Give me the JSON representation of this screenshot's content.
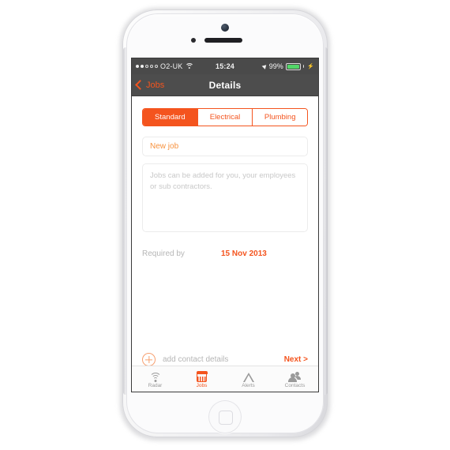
{
  "device": {
    "name": "white-iphone-5",
    "camera_icon": "camera-icon",
    "speaker_icon": "speaker-grille-icon",
    "home_button_icon": "home-button-icon"
  },
  "status_bar": {
    "signal_icon": "signal-dots-icon",
    "signal_bars_filled": 2,
    "signal_bars_total": 5,
    "carrier": "O2-UK",
    "wifi_icon": "wifi-icon",
    "time": "15:24",
    "location_icon": "location-arrow-icon",
    "battery_percent": "99%",
    "battery_level": 99,
    "battery_icon": "battery-icon",
    "charging_icon": "lightning-bolt-icon",
    "battery_color": "#53d769",
    "background_color": "#4a4a4a"
  },
  "nav_bar": {
    "back_icon": "chevron-left-icon",
    "back_label": "Jobs",
    "title": "Details",
    "background_color": "#4d4d4d",
    "accent_color": "#f4541e"
  },
  "segmented_control": {
    "options": [
      {
        "label": "Standard",
        "selected": true
      },
      {
        "label": "Electrical",
        "selected": false
      },
      {
        "label": "Plumbing",
        "selected": false
      }
    ]
  },
  "form": {
    "title_field": {
      "value": "",
      "placeholder": "New job"
    },
    "description_field": {
      "value": "",
      "placeholder": "Jobs can be added for you, your employees or sub contractors."
    },
    "required_by": {
      "label": "Required by",
      "value": "15 Nov 2013"
    }
  },
  "actions": {
    "add_contact_icon": "plus-circle-icon",
    "add_contact_label": "add contact details",
    "next_label": "Next >"
  },
  "tab_bar": {
    "tabs": [
      {
        "label": "Radar",
        "icon": "radar-icon",
        "active": false
      },
      {
        "label": "Jobs",
        "icon": "calendar-icon",
        "active": true
      },
      {
        "label": "Alerts",
        "icon": "triangle-alert-icon",
        "active": false
      },
      {
        "label": "Contacts",
        "icon": "contacts-icon",
        "active": false
      }
    ]
  },
  "theme": {
    "accent": "#f4541e",
    "placeholder_orange": "#f7923f",
    "muted_gray": "#b6b6b6"
  }
}
